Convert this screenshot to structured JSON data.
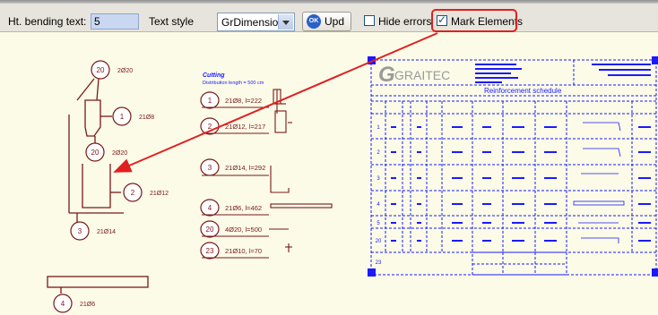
{
  "toolbar": {
    "bending_label": "Ht. bending text:",
    "bending_value": "5",
    "text_style_label": "Text style",
    "text_style_value": "GrDimensions",
    "ok_badge": "OK",
    "upd_label": "Upd",
    "hide_errors_label": "Hide errors",
    "hide_errors_checked": false,
    "mark_elements_label": "Mark Elements",
    "mark_elements_checked": true
  },
  "colors": {
    "background": "#fbfbe8",
    "drawing": "#7a1818",
    "marker_red": "#e02020",
    "title_block_blue": "#1a1aff",
    "grip_blue": "#1e6fe0"
  },
  "drawing": {
    "bubbles": [
      {
        "num": "20",
        "label": "2Ø20"
      },
      {
        "num": "1",
        "label": "21Ø8"
      },
      {
        "num": "20",
        "label": "2Ø20"
      },
      {
        "num": "2",
        "label": "21Ø12"
      },
      {
        "num": "3",
        "label": "21Ø14"
      },
      {
        "num": "4",
        "label": "21Ø6"
      }
    ],
    "cuts_title": "Cutting",
    "cuts_subtitle": "Distribution length = 500 cm",
    "cut_rows": [
      {
        "num": "1",
        "text": "21Ø8, l=222"
      },
      {
        "num": "2",
        "text": "21Ø12, l=217"
      },
      {
        "num": "3",
        "text": "21Ø14, l=292"
      },
      {
        "num": "4",
        "text": "21Ø6, l=462"
      },
      {
        "num": "20",
        "text": "4Ø20, l=500"
      },
      {
        "num": "23",
        "text": "21Ø10, l=70"
      }
    ]
  },
  "title_block": {
    "logo": "GRAITEC",
    "schedule_title": "Reinforcement schedule",
    "rows": [
      "1",
      "2",
      "3",
      "4",
      "5",
      "20",
      "23"
    ]
  }
}
